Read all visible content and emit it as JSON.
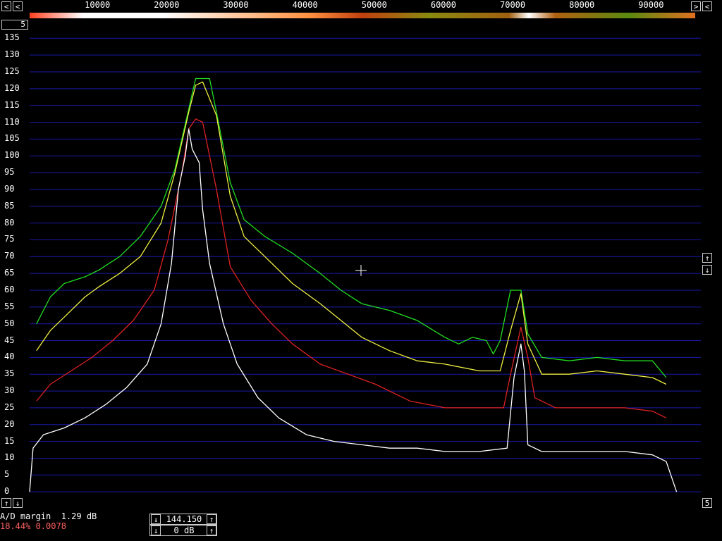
{
  "frequency_axis": {
    "labels": [
      "10000",
      "20000",
      "30000",
      "40000",
      "50000",
      "60000",
      "70000",
      "80000",
      "90000"
    ],
    "values": [
      10000,
      20000,
      30000,
      40000,
      50000,
      60000,
      70000,
      80000,
      90000
    ]
  },
  "nav": {
    "left_arrow": "<",
    "right_arrow": ">",
    "right_arrow2": "<",
    "left_arrow2": "<",
    "top_left_box": "5",
    "up_arrow": "↑",
    "down_arrow": "↓",
    "bottom_right_box": "5"
  },
  "y_axis": {
    "labels": [
      "135",
      "130",
      "125",
      "120",
      "115",
      "110",
      "105",
      "100",
      "95",
      "90",
      "85",
      "80",
      "75",
      "70",
      "65",
      "60",
      "55",
      "50",
      "45",
      "40",
      "35",
      "30",
      "25",
      "20",
      "15",
      "10",
      "5",
      "0"
    ]
  },
  "status": {
    "ad_margin": "A/D margin  1.29 dB",
    "percent_line": "18.44% 0.0078",
    "freq_box": "144.150",
    "db_box": "0 dB"
  },
  "colors": {
    "grid": "#1a1aa8",
    "trace_green": "#22dd22",
    "trace_yellow": "#eeee44",
    "trace_red": "#dd2222",
    "trace_white": "#ffffff",
    "status_red": "#ff6060"
  },
  "chart_data": {
    "type": "line",
    "xlim": [
      0,
      97000
    ],
    "ylim": [
      -5,
      138
    ],
    "series": [
      {
        "values": [
          [
            1000,
            50
          ],
          [
            3000,
            58
          ],
          [
            5000,
            62
          ],
          [
            8000,
            64
          ],
          [
            10000,
            66
          ],
          [
            13000,
            70
          ],
          [
            16000,
            76
          ],
          [
            19000,
            85
          ],
          [
            21000,
            96
          ],
          [
            23000,
            114
          ],
          [
            24000,
            123
          ],
          [
            26000,
            123
          ],
          [
            27000,
            113
          ],
          [
            29000,
            92
          ],
          [
            31000,
            81
          ],
          [
            34000,
            76
          ],
          [
            38000,
            71
          ],
          [
            42000,
            65
          ],
          [
            45000,
            60
          ],
          [
            48000,
            56
          ],
          [
            52000,
            54
          ],
          [
            56000,
            51
          ],
          [
            60000,
            46
          ],
          [
            62000,
            44
          ],
          [
            64000,
            46
          ],
          [
            66000,
            45
          ],
          [
            67000,
            41
          ],
          [
            68000,
            45
          ],
          [
            69500,
            60
          ],
          [
            71000,
            60
          ],
          [
            72000,
            47
          ],
          [
            74000,
            40
          ],
          [
            78000,
            39
          ],
          [
            82000,
            40
          ],
          [
            86000,
            39
          ],
          [
            90000,
            39
          ],
          [
            92000,
            34
          ]
        ]
      },
      {
        "values": [
          [
            1000,
            42
          ],
          [
            3000,
            48
          ],
          [
            5000,
            52
          ],
          [
            8000,
            58
          ],
          [
            10000,
            61
          ],
          [
            13000,
            65
          ],
          [
            16000,
            70
          ],
          [
            19000,
            80
          ],
          [
            21000,
            95
          ],
          [
            23000,
            113
          ],
          [
            24000,
            121
          ],
          [
            25000,
            122
          ],
          [
            27000,
            112
          ],
          [
            29000,
            88
          ],
          [
            31000,
            76
          ],
          [
            34000,
            70
          ],
          [
            38000,
            62
          ],
          [
            42000,
            56
          ],
          [
            45000,
            51
          ],
          [
            48000,
            46
          ],
          [
            52000,
            42
          ],
          [
            56000,
            39
          ],
          [
            60000,
            38
          ],
          [
            65000,
            36
          ],
          [
            68000,
            36
          ],
          [
            69500,
            48
          ],
          [
            71000,
            59
          ],
          [
            72000,
            44
          ],
          [
            74000,
            35
          ],
          [
            78000,
            35
          ],
          [
            82000,
            36
          ],
          [
            86000,
            35
          ],
          [
            90000,
            34
          ],
          [
            92000,
            32
          ]
        ]
      },
      {
        "values": [
          [
            1000,
            27
          ],
          [
            3000,
            32
          ],
          [
            6000,
            36
          ],
          [
            9000,
            40
          ],
          [
            12000,
            45
          ],
          [
            15000,
            51
          ],
          [
            18000,
            60
          ],
          [
            20000,
            75
          ],
          [
            22000,
            95
          ],
          [
            23000,
            108
          ],
          [
            24000,
            111
          ],
          [
            25000,
            110
          ],
          [
            27000,
            90
          ],
          [
            29000,
            67
          ],
          [
            32000,
            57
          ],
          [
            35000,
            50
          ],
          [
            38000,
            44
          ],
          [
            42000,
            38
          ],
          [
            46000,
            35
          ],
          [
            50000,
            32
          ],
          [
            55000,
            27
          ],
          [
            60000,
            25
          ],
          [
            65000,
            25
          ],
          [
            68500,
            25
          ],
          [
            69500,
            35
          ],
          [
            71000,
            49
          ],
          [
            72000,
            40
          ],
          [
            73000,
            28
          ],
          [
            76000,
            25
          ],
          [
            82000,
            25
          ],
          [
            86000,
            25
          ],
          [
            90000,
            24
          ],
          [
            92000,
            22
          ]
        ]
      },
      {
        "values": [
          [
            0,
            0
          ],
          [
            500,
            13
          ],
          [
            2000,
            17
          ],
          [
            5000,
            19
          ],
          [
            8000,
            22
          ],
          [
            11000,
            26
          ],
          [
            14000,
            31
          ],
          [
            17000,
            38
          ],
          [
            19000,
            50
          ],
          [
            20500,
            68
          ],
          [
            21500,
            90
          ],
          [
            22500,
            100
          ],
          [
            23000,
            108
          ],
          [
            23500,
            102
          ],
          [
            24000,
            100
          ],
          [
            24500,
            98
          ],
          [
            25000,
            84
          ],
          [
            26000,
            68
          ],
          [
            28000,
            50
          ],
          [
            30000,
            38
          ],
          [
            33000,
            28
          ],
          [
            36000,
            22
          ],
          [
            40000,
            17
          ],
          [
            44000,
            15
          ],
          [
            48000,
            14
          ],
          [
            52000,
            13
          ],
          [
            56000,
            13
          ],
          [
            60000,
            12
          ],
          [
            65000,
            12
          ],
          [
            69000,
            13
          ],
          [
            70000,
            34
          ],
          [
            71000,
            44
          ],
          [
            71500,
            36
          ],
          [
            72000,
            14
          ],
          [
            74000,
            12
          ],
          [
            80000,
            12
          ],
          [
            86000,
            12
          ],
          [
            90000,
            11
          ],
          [
            92000,
            9
          ],
          [
            93500,
            0
          ]
        ]
      }
    ]
  }
}
